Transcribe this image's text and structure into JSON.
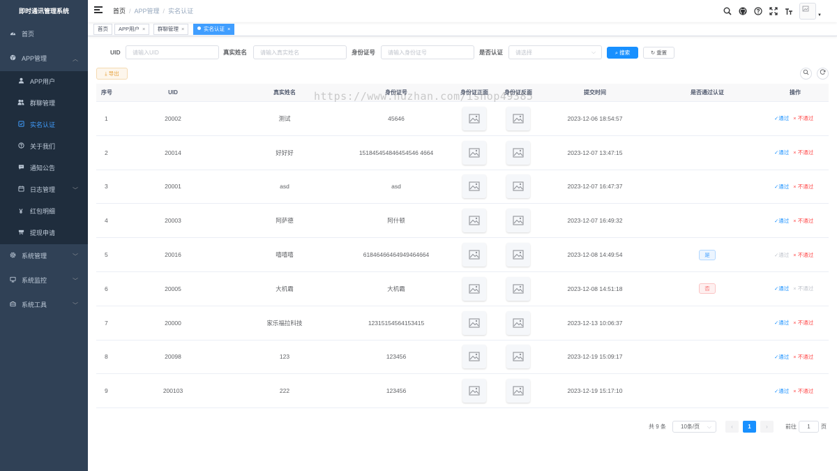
{
  "app": {
    "title": "即时通讯管理系统"
  },
  "sidebar": {
    "items": [
      {
        "label": "首页",
        "icon": "dashboard-icon"
      },
      {
        "label": "APP管理",
        "icon": "globe-icon",
        "expanded": true,
        "children": [
          {
            "label": "APP用户",
            "icon": "user-icon"
          },
          {
            "label": "群聊管理",
            "icon": "peoples-icon"
          },
          {
            "label": "实名认证",
            "icon": "checkbox-icon",
            "active": true
          },
          {
            "label": "关于我们",
            "icon": "question-icon"
          },
          {
            "label": "通知公告",
            "icon": "message-icon"
          },
          {
            "label": "日志管理",
            "icon": "log-icon"
          },
          {
            "label": "红包明细",
            "icon": "yen-icon"
          },
          {
            "label": "提现申请",
            "icon": "withdraw-icon"
          }
        ]
      },
      {
        "label": "系统管理",
        "icon": "gear-icon"
      },
      {
        "label": "系统监控",
        "icon": "monitor-icon"
      },
      {
        "label": "系统工具",
        "icon": "toolbox-icon"
      }
    ]
  },
  "navbar": {
    "breadcrumb": [
      "首页",
      "APP管理",
      "实名认证"
    ]
  },
  "tags": [
    {
      "label": "首页",
      "closable": false
    },
    {
      "label": "APP用户",
      "closable": true
    },
    {
      "label": "群聊管理",
      "closable": true
    },
    {
      "label": "实名认证",
      "closable": true,
      "active": true
    }
  ],
  "search": {
    "uid_label": "UID",
    "uid_placeholder": "请输入UID",
    "name_label": "真实姓名",
    "name_placeholder": "请输入真实姓名",
    "idcard_label": "身份证号",
    "idcard_placeholder": "请输入身份证号",
    "verified_label": "是否认证",
    "verified_placeholder": "请选择",
    "search_button": "搜索",
    "reset_button": "重置"
  },
  "toolbar": {
    "export_button": "导出"
  },
  "table": {
    "headers": [
      "序号",
      "UID",
      "真实姓名",
      "身份证号",
      "身份证正面",
      "身份证反面",
      "提交时间",
      "是否通过认证",
      "操作"
    ],
    "rows": [
      {
        "index": "1",
        "uid": "20002",
        "name": "测试",
        "idcard": "45646",
        "time": "2023-12-06 18:54:57",
        "status": "",
        "pass": "通过",
        "fail": "不通过",
        "pass_disabled": false,
        "fail_disabled": false
      },
      {
        "index": "2",
        "uid": "20014",
        "name": "好好好",
        "idcard": "151845454846454546 4664",
        "time": "2023-12-07 13:47:15",
        "status": "",
        "pass": "通过",
        "fail": "不通过",
        "pass_disabled": false,
        "fail_disabled": false
      },
      {
        "index": "3",
        "uid": "20001",
        "name": "asd",
        "idcard": "asd",
        "time": "2023-12-07 16:47:37",
        "status": "",
        "pass": "通过",
        "fail": "不通过",
        "pass_disabled": false,
        "fail_disabled": false
      },
      {
        "index": "4",
        "uid": "20003",
        "name": "阿萨德",
        "idcard": "阿什顿",
        "time": "2023-12-07 16:49:32",
        "status": "",
        "pass": "通过",
        "fail": "不通过",
        "pass_disabled": false,
        "fail_disabled": false
      },
      {
        "index": "5",
        "uid": "20016",
        "name": "嘻嘻嘻",
        "idcard": "61846466464949464664",
        "time": "2023-12-08 14:49:54",
        "status": "是",
        "pass": "通过",
        "fail": "不通过",
        "pass_disabled": true,
        "fail_disabled": false
      },
      {
        "index": "6",
        "uid": "20005",
        "name": "大机霸",
        "idcard": "大机霸",
        "time": "2023-12-08 14:51:18",
        "status": "否",
        "pass": "通过",
        "fail": "不通过",
        "pass_disabled": false,
        "fail_disabled": true
      },
      {
        "index": "7",
        "uid": "20000",
        "name": "家乐福拉科技",
        "idcard": "12315154564153415",
        "time": "2023-12-13 10:06:37",
        "status": "",
        "pass": "通过",
        "fail": "不通过",
        "pass_disabled": false,
        "fail_disabled": false
      },
      {
        "index": "8",
        "uid": "20098",
        "name": "123",
        "idcard": "123456",
        "time": "2023-12-19 15:09:17",
        "status": "",
        "pass": "通过",
        "fail": "不通过",
        "pass_disabled": false,
        "fail_disabled": false
      },
      {
        "index": "9",
        "uid": "200103",
        "name": "222",
        "idcard": "123456",
        "time": "2023-12-19 15:17:10",
        "status": "",
        "pass": "通过",
        "fail": "不通过",
        "pass_disabled": false,
        "fail_disabled": false
      }
    ]
  },
  "pagination": {
    "total": "共 9 条",
    "page_size": "10条/页",
    "current": "1",
    "goto_prefix": "前往",
    "goto_value": "1",
    "goto_suffix": "页"
  },
  "watermark": "https://www.huzhan.com/ishop49385",
  "colors": {
    "sidebar_bg": "#304156",
    "accent": "#1890ff",
    "danger": "#ff4949"
  }
}
